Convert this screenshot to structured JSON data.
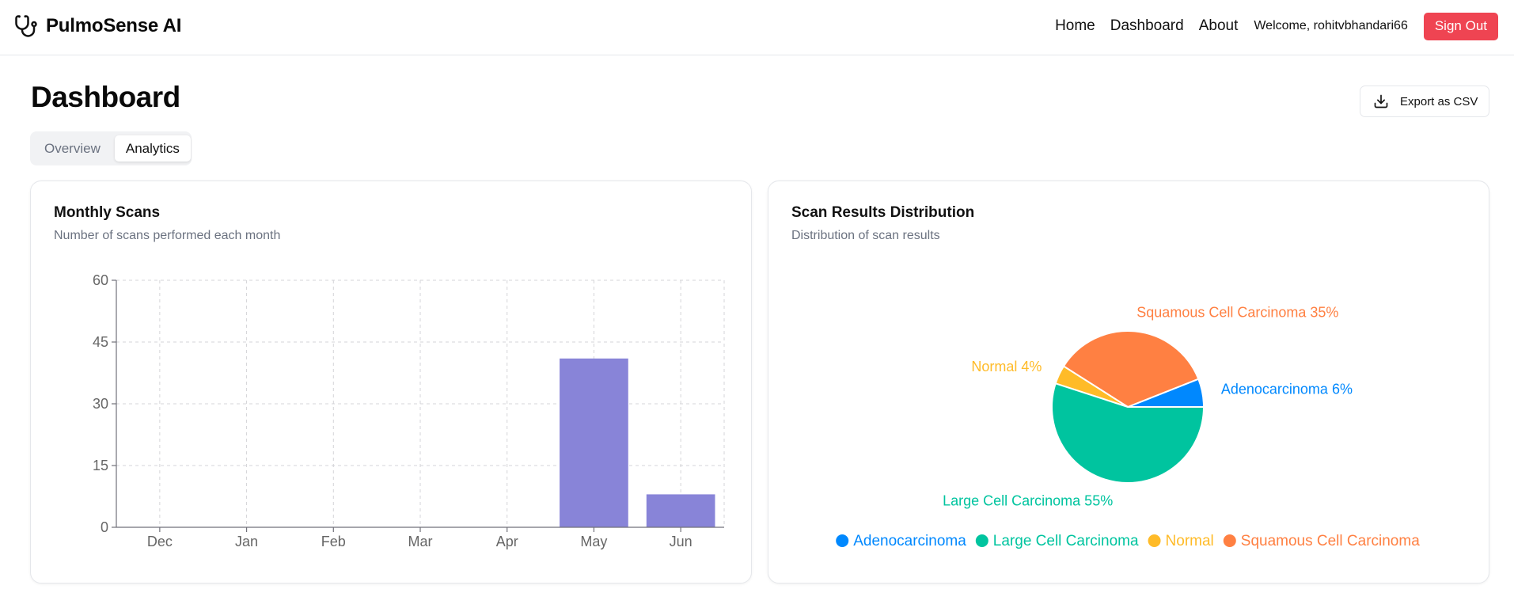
{
  "app": {
    "name": "PulmoSense AI",
    "icon": "stethoscope-icon"
  },
  "nav": {
    "home": "Home",
    "dashboard": "Dashboard",
    "about": "About",
    "welcome": "Welcome, rohitvbhandari66",
    "sign_out": "Sign Out"
  },
  "page": {
    "title": "Dashboard",
    "export_label": "Export as CSV",
    "export_icon": "download-icon"
  },
  "tabs": [
    {
      "label": "Overview",
      "active": false
    },
    {
      "label": "Analytics",
      "active": true
    }
  ],
  "monthly_card": {
    "title": "Monthly Scans",
    "description": "Number of scans performed each month"
  },
  "distribution_card": {
    "title": "Scan Results Distribution",
    "description": "Distribution of scan results"
  },
  "colors": {
    "accent_red": "#ef4452",
    "bar": "#8884d8",
    "adenocarcinoma": "#0088fe",
    "large_cell": "#00c49f",
    "normal": "#ffbb28",
    "squamous": "#ff8042"
  },
  "chart_data": [
    {
      "type": "bar",
      "categories": [
        "Dec",
        "Jan",
        "Feb",
        "Mar",
        "Apr",
        "May",
        "Jun"
      ],
      "values": [
        0,
        0,
        0,
        0,
        0,
        41,
        8
      ],
      "yticks": [
        0,
        15,
        30,
        45,
        60
      ],
      "ylim": [
        0,
        60
      ],
      "grid": true
    },
    {
      "type": "pie",
      "slices": [
        {
          "label": "Adenocarcinoma",
          "value": 6,
          "color": "#0088fe"
        },
        {
          "label": "Squamous Cell Carcinoma",
          "value": 35,
          "color": "#ff8042"
        },
        {
          "label": "Normal",
          "value": 4,
          "color": "#ffbb28"
        },
        {
          "label": "Large Cell Carcinoma",
          "value": 55,
          "color": "#00c49f"
        }
      ],
      "legend": [
        "Adenocarcinoma",
        "Large Cell Carcinoma",
        "Normal",
        "Squamous Cell Carcinoma"
      ],
      "legend_placement": "bottom"
    }
  ]
}
